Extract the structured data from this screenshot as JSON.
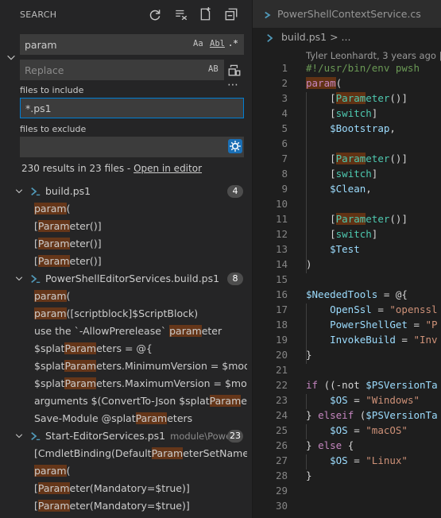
{
  "search": {
    "title": "SEARCH",
    "query": "param",
    "replace_placeholder": "Replace",
    "files_to_include_label": "files to include",
    "files_to_include_value": "*.ps1",
    "files_to_exclude_label": "files to exclude",
    "files_to_exclude_value": "",
    "options": {
      "match_case": "Aa",
      "whole_word": "Abl",
      "regex": ".*",
      "preserve_case": "AB"
    },
    "summary_text": "230 results in 23 files - ",
    "open_in_editor": "Open in editor"
  },
  "results": [
    {
      "file": "build.ps1",
      "dir": "",
      "count": "4",
      "matches": [
        {
          "pre": "",
          "hit": "param",
          "post": "("
        },
        {
          "pre": "[",
          "hit": "Param",
          "post": "eter()]"
        },
        {
          "pre": "[",
          "hit": "Param",
          "post": "eter()]"
        },
        {
          "pre": "[",
          "hit": "Param",
          "post": "eter()]"
        }
      ]
    },
    {
      "file": "PowerShellEditorServices.build.ps1",
      "dir": "",
      "count": "8",
      "matches": [
        {
          "pre": "",
          "hit": "param",
          "post": "("
        },
        {
          "pre": "",
          "hit": "param",
          "post": "([scriptblock]$ScriptBlock)"
        },
        {
          "pre": "use the `-AllowPrerelease` ",
          "hit": "param",
          "post": "eter"
        },
        {
          "pre": "$splat",
          "hit": "Param",
          "post": "eters = @{"
        },
        {
          "pre": "$splat",
          "hit": "Param",
          "post": "eters.MinimumVersion = $modul..."
        },
        {
          "pre": "$splat",
          "hit": "Param",
          "post": "eters.MaximumVersion = $modul..."
        },
        {
          "pre": "arguments $(ConvertTo-Json $splat",
          "hit": "Param",
          "post": "eter..."
        },
        {
          "pre": "Save-Module @splat",
          "hit": "Param",
          "post": "eters"
        }
      ]
    },
    {
      "file": "Start-EditorServices.ps1",
      "dir": "module\\Powe...",
      "count": "23",
      "matches": [
        {
          "pre": "[CmdletBinding(Default",
          "hit": "Param",
          "post": "eterSetName=\"..."
        },
        {
          "pre": "",
          "hit": "param",
          "post": "("
        },
        {
          "pre": "[",
          "hit": "Param",
          "post": "eter(Mandatory=$true)]"
        },
        {
          "pre": "[",
          "hit": "Param",
          "post": "eter(Mandatory=$true)]"
        }
      ]
    }
  ],
  "editor": {
    "tab_label": "PowerShellContextService.cs",
    "breadcrumb": "build.ps1 > ...",
    "blame": "Tyler Leonhardt, 3 years ago |"
  },
  "code_lines": [
    {
      "n": "1",
      "tokens": [
        {
          "t": "#!/usr/bin/env pwsh",
          "c": "c-shebang"
        }
      ]
    },
    {
      "n": "2",
      "tokens": [
        {
          "t": "param",
          "c": "c-kw hl"
        },
        {
          "t": "(",
          "c": "c-op"
        }
      ]
    },
    {
      "n": "3",
      "tokens": [
        {
          "t": "    [",
          "c": "c-op"
        },
        {
          "t": "Param",
          "c": "c-type hl"
        },
        {
          "t": "eter",
          "c": "c-type"
        },
        {
          "t": "()]",
          "c": "c-op"
        }
      ]
    },
    {
      "n": "4",
      "tokens": [
        {
          "t": "    [",
          "c": "c-op"
        },
        {
          "t": "switch",
          "c": "c-type"
        },
        {
          "t": "]",
          "c": "c-op"
        }
      ]
    },
    {
      "n": "5",
      "tokens": [
        {
          "t": "    ",
          "c": "c-op"
        },
        {
          "t": "$Bootstrap",
          "c": "c-var"
        },
        {
          "t": ",",
          "c": "c-op"
        }
      ]
    },
    {
      "n": "6",
      "tokens": []
    },
    {
      "n": "7",
      "tokens": [
        {
          "t": "    [",
          "c": "c-op"
        },
        {
          "t": "Param",
          "c": "c-type hl"
        },
        {
          "t": "eter",
          "c": "c-type"
        },
        {
          "t": "()]",
          "c": "c-op"
        }
      ]
    },
    {
      "n": "8",
      "tokens": [
        {
          "t": "    [",
          "c": "c-op"
        },
        {
          "t": "switch",
          "c": "c-type"
        },
        {
          "t": "]",
          "c": "c-op"
        }
      ]
    },
    {
      "n": "9",
      "tokens": [
        {
          "t": "    ",
          "c": "c-op"
        },
        {
          "t": "$Clean",
          "c": "c-var"
        },
        {
          "t": ",",
          "c": "c-op"
        }
      ]
    },
    {
      "n": "10",
      "tokens": []
    },
    {
      "n": "11",
      "tokens": [
        {
          "t": "    [",
          "c": "c-op"
        },
        {
          "t": "Param",
          "c": "c-type hl"
        },
        {
          "t": "eter",
          "c": "c-type"
        },
        {
          "t": "()]",
          "c": "c-op"
        }
      ]
    },
    {
      "n": "12",
      "tokens": [
        {
          "t": "    [",
          "c": "c-op"
        },
        {
          "t": "switch",
          "c": "c-type"
        },
        {
          "t": "]",
          "c": "c-op"
        }
      ]
    },
    {
      "n": "13",
      "tokens": [
        {
          "t": "    ",
          "c": "c-op"
        },
        {
          "t": "$Test",
          "c": "c-var"
        }
      ]
    },
    {
      "n": "14",
      "tokens": [
        {
          "t": ")",
          "c": "c-op"
        }
      ]
    },
    {
      "n": "15",
      "tokens": []
    },
    {
      "n": "16",
      "tokens": [
        {
          "t": "$NeededTools",
          "c": "c-var"
        },
        {
          "t": " = @{",
          "c": "c-op"
        }
      ]
    },
    {
      "n": "17",
      "tokens": [
        {
          "t": "    ",
          "c": "c-op"
        },
        {
          "t": "OpenSsl",
          "c": "c-var"
        },
        {
          "t": " = ",
          "c": "c-op"
        },
        {
          "t": "\"openssl",
          "c": "c-str"
        }
      ]
    },
    {
      "n": "18",
      "tokens": [
        {
          "t": "    ",
          "c": "c-op"
        },
        {
          "t": "PowerShellGet",
          "c": "c-var"
        },
        {
          "t": " = ",
          "c": "c-op"
        },
        {
          "t": "\"P",
          "c": "c-str"
        }
      ]
    },
    {
      "n": "19",
      "tokens": [
        {
          "t": "    ",
          "c": "c-op"
        },
        {
          "t": "InvokeBuild",
          "c": "c-var"
        },
        {
          "t": " = ",
          "c": "c-op"
        },
        {
          "t": "\"Inv",
          "c": "c-str"
        }
      ]
    },
    {
      "n": "20",
      "tokens": [
        {
          "t": "}",
          "c": "c-op"
        }
      ]
    },
    {
      "n": "21",
      "tokens": []
    },
    {
      "n": "22",
      "tokens": [
        {
          "t": "if",
          "c": "c-kw"
        },
        {
          "t": " ((-not ",
          "c": "c-op"
        },
        {
          "t": "$PSVersionTa",
          "c": "c-var"
        }
      ]
    },
    {
      "n": "23",
      "tokens": [
        {
          "t": "    ",
          "c": "c-op"
        },
        {
          "t": "$OS",
          "c": "c-var"
        },
        {
          "t": " = ",
          "c": "c-op"
        },
        {
          "t": "\"Windows\"",
          "c": "c-str"
        }
      ]
    },
    {
      "n": "24",
      "tokens": [
        {
          "t": "} ",
          "c": "c-op"
        },
        {
          "t": "elseif",
          "c": "c-kw"
        },
        {
          "t": " (",
          "c": "c-op"
        },
        {
          "t": "$PSVersionTa",
          "c": "c-var"
        }
      ]
    },
    {
      "n": "25",
      "tokens": [
        {
          "t": "    ",
          "c": "c-op"
        },
        {
          "t": "$OS",
          "c": "c-var"
        },
        {
          "t": " = ",
          "c": "c-op"
        },
        {
          "t": "\"macOS\"",
          "c": "c-str"
        }
      ]
    },
    {
      "n": "26",
      "tokens": [
        {
          "t": "} ",
          "c": "c-op"
        },
        {
          "t": "else",
          "c": "c-kw"
        },
        {
          "t": " {",
          "c": "c-op"
        }
      ]
    },
    {
      "n": "27",
      "tokens": [
        {
          "t": "    ",
          "c": "c-op"
        },
        {
          "t": "$OS",
          "c": "c-var"
        },
        {
          "t": " = ",
          "c": "c-op"
        },
        {
          "t": "\"Linux\"",
          "c": "c-str"
        }
      ]
    },
    {
      "n": "28",
      "tokens": [
        {
          "t": "}",
          "c": "c-op"
        }
      ]
    },
    {
      "n": "29",
      "tokens": []
    },
    {
      "n": "30",
      "tokens": []
    }
  ]
}
